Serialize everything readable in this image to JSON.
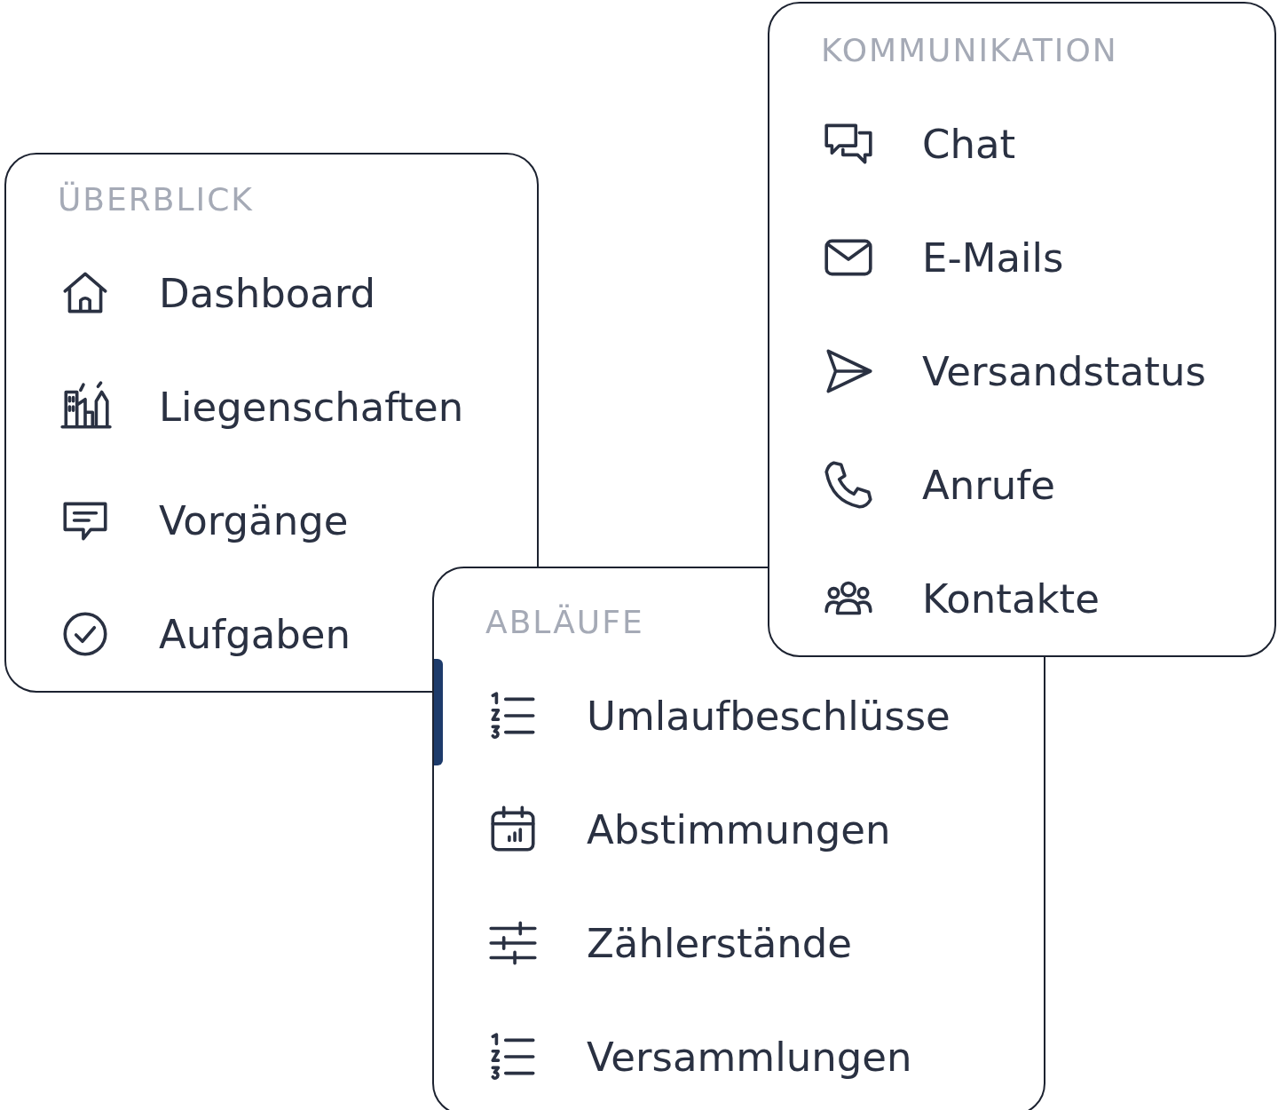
{
  "sections": [
    {
      "heading": "ÜBERBLICK",
      "items": [
        {
          "label": "Dashboard",
          "selected": false
        },
        {
          "label": "Liegenschaften",
          "selected": false
        },
        {
          "label": "Vorgänge",
          "selected": false
        },
        {
          "label": "Aufgaben",
          "selected": false
        }
      ]
    },
    {
      "heading": "KOMMUNIKATION",
      "items": [
        {
          "label": "Chat",
          "selected": false
        },
        {
          "label": "E-Mails",
          "selected": false
        },
        {
          "label": "Versandstatus",
          "selected": false
        },
        {
          "label": "Anrufe",
          "selected": false
        },
        {
          "label": "Kontakte",
          "selected": false
        }
      ]
    },
    {
      "heading": "ABLÄUFE",
      "items": [
        {
          "label": "Umlaufbeschlüsse",
          "selected": true
        },
        {
          "label": "Abstimmungen",
          "selected": false
        },
        {
          "label": "Zählerstände",
          "selected": false
        },
        {
          "label": "Versammlungen",
          "selected": false
        }
      ]
    }
  ]
}
